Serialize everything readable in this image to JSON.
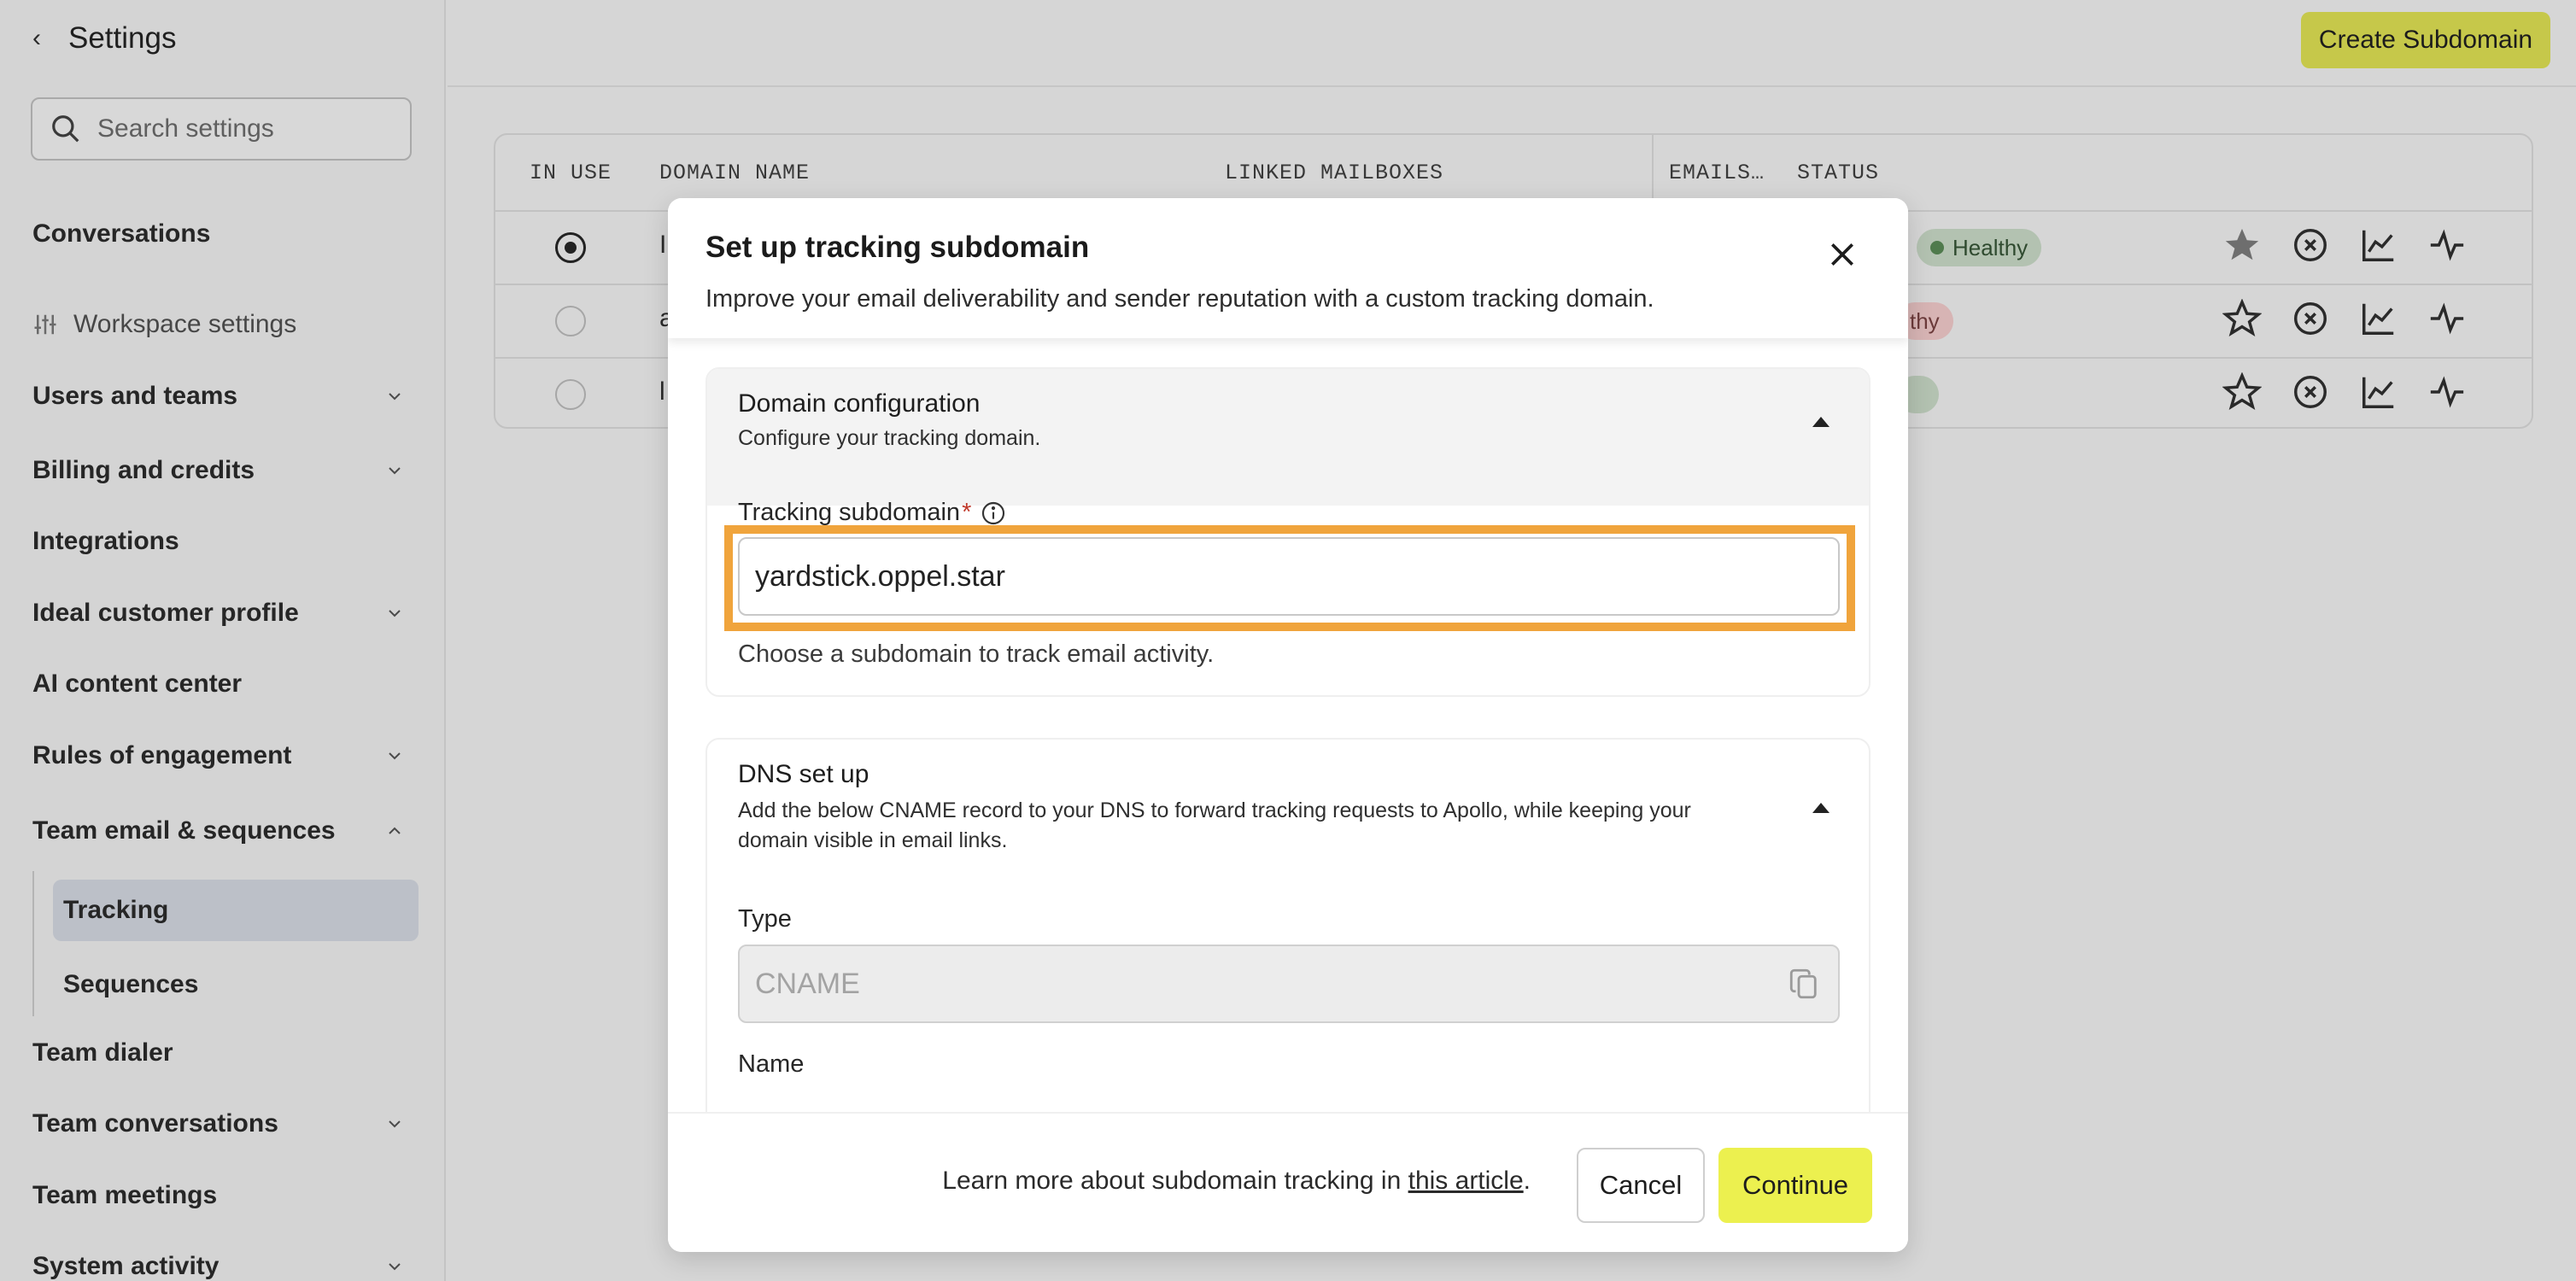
{
  "sidebar": {
    "title": "Settings",
    "search_placeholder": "Search settings",
    "items": [
      {
        "label": "Conversations"
      },
      {
        "label": "Workspace settings"
      },
      {
        "label": "Users and teams"
      },
      {
        "label": "Billing and credits"
      },
      {
        "label": "Integrations"
      },
      {
        "label": "Ideal customer profile"
      },
      {
        "label": "AI content center"
      },
      {
        "label": "Rules of engagement"
      },
      {
        "label": "Team email & sequences"
      },
      {
        "label": "Tracking"
      },
      {
        "label": "Sequences"
      },
      {
        "label": "Team dialer"
      },
      {
        "label": "Team conversations"
      },
      {
        "label": "Team meetings"
      },
      {
        "label": "System activity"
      }
    ]
  },
  "header": {
    "create_button": "Create Subdomain"
  },
  "table": {
    "columns": [
      "IN USE",
      "DOMAIN NAME",
      "LINKED MAILBOXES",
      "EMAILS…",
      "STATUS"
    ],
    "rows": [
      {
        "in_use": true,
        "domain_peek": "I",
        "status": "Healthy",
        "status_color": "#4f7a4c"
      },
      {
        "in_use": false,
        "domain_peek": "a",
        "status": "thy",
        "status_color": "#b35c5c"
      },
      {
        "in_use": false,
        "domain_peek": "l",
        "status": "",
        "status_color": "#4f7a4c"
      }
    ]
  },
  "modal": {
    "title": "Set up tracking subdomain",
    "subtitle": "Improve your email deliverability and sender reputation with a custom tracking domain.",
    "domain_section": {
      "title": "Domain configuration",
      "description": "Configure your tracking domain.",
      "field_label": "Tracking subdomain",
      "required_mark": "*",
      "field_value": "yardstick.oppel.star",
      "helper": "Choose a subdomain to track email activity."
    },
    "dns_section": {
      "title": "DNS set up",
      "description": "Add the below CNAME record to your DNS to forward tracking requests to Apollo, while keeping your domain visible in email links.",
      "type_label": "Type",
      "type_value": "CNAME",
      "name_label": "Name"
    },
    "footer": {
      "learn_prefix": "Learn more about subdomain tracking in ",
      "learn_link": "this article",
      "learn_suffix": ".",
      "cancel": "Cancel",
      "continue": "Continue"
    }
  },
  "colors": {
    "accent_button": "#ecf04f",
    "highlight": "#f0a43c",
    "healthy": "#4f7a4c"
  }
}
